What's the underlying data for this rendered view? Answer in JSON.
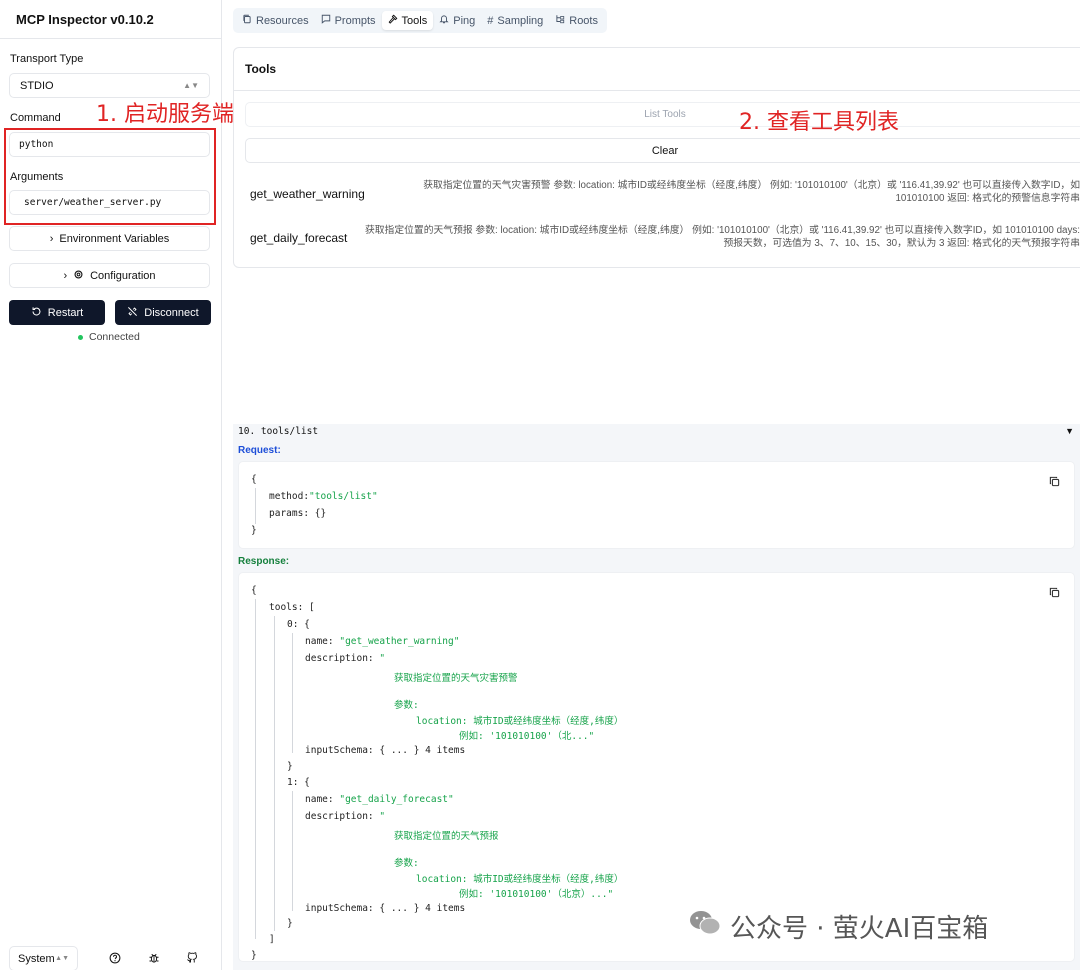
{
  "app": {
    "title": "MCP Inspector v0.10.2"
  },
  "sidebar": {
    "transport_label": "Transport Type",
    "transport_value": "STDIO",
    "command_label": "Command",
    "command_value": "python",
    "arguments_label": "Arguments",
    "arguments_value": "server/weather_server.py",
    "env_vars_label": "Environment Variables",
    "config_label": "Configuration",
    "restart_label": "Restart",
    "disconnect_label": "Disconnect",
    "status_text": "Connected",
    "theme_value": "System"
  },
  "annotations": {
    "step1": "1. 启动服务端",
    "step2": "2. 查看工具列表"
  },
  "tabs": [
    {
      "label": "Resources",
      "icon": "copy-icon"
    },
    {
      "label": "Prompts",
      "icon": "message-icon"
    },
    {
      "label": "Tools",
      "icon": "hammer-icon",
      "active": true
    },
    {
      "label": "Ping",
      "icon": "bell-icon"
    },
    {
      "label": "Sampling",
      "icon": "hash-icon"
    },
    {
      "label": "Roots",
      "icon": "folder-tree-icon"
    }
  ],
  "tools_panel": {
    "title": "Tools",
    "list_label": "List Tools",
    "clear_label": "Clear",
    "items": [
      {
        "name": "get_weather_warning",
        "desc_line1": "获取指定位置的天气灾害预警 参数: location: 城市ID或经纬度坐标（经度,纬度） 例如: '101010100'（北京）或 '116.41,39.92' 也可以直接传入数字ID，如",
        "desc_line2": "101010100 返回: 格式化的预警信息字符串"
      },
      {
        "name": "get_daily_forecast",
        "desc_line1": "获取指定位置的天气预报 参数: location: 城市ID或经纬度坐标（经度,纬度） 例如: '101010100'（北京）或 '116.41,39.92' 也可以直接传入数字ID，如 101010100 days:",
        "desc_line2": "预报天数，可选值为 3、7、10、15、30，默认为 3 返回: 格式化的天气预报字符串"
      }
    ]
  },
  "history": {
    "entry_title": "10. tools/list",
    "request_label": "Request:",
    "response_label": "Response:",
    "request": {
      "open": "{",
      "method_key": "method:",
      "method_val": "\"tools/list\"",
      "params_key": "params:",
      "params_val": "{}",
      "close": "}"
    },
    "response": {
      "open": "{",
      "tools_key": "tools: [",
      "item0_key": "0: {",
      "item1_key": "1: {",
      "name_key": "name:",
      "name0": "\"get_weather_warning\"",
      "name1": "\"get_daily_forecast\"",
      "desc_key": "description:",
      "desc_quote": "\"",
      "d0_line1": "获取指定位置的天气灾害预警",
      "d1_line1": "获取指定位置的天气预报",
      "param_label": "参数:",
      "location_line": "location: 城市ID或经纬度坐标（经度,纬度）",
      "d0_example": "例如: '101010100'（北...\"",
      "d1_example": "例如: '101010100'（北京）...\"",
      "schema_key": "inputSchema:",
      "schema_val": "{ ... }",
      "schema_count": "4 items",
      "close_obj": "}",
      "close_arr": "]",
      "close": "}"
    }
  },
  "watermark": "公众号 · 萤火AI百宝箱"
}
